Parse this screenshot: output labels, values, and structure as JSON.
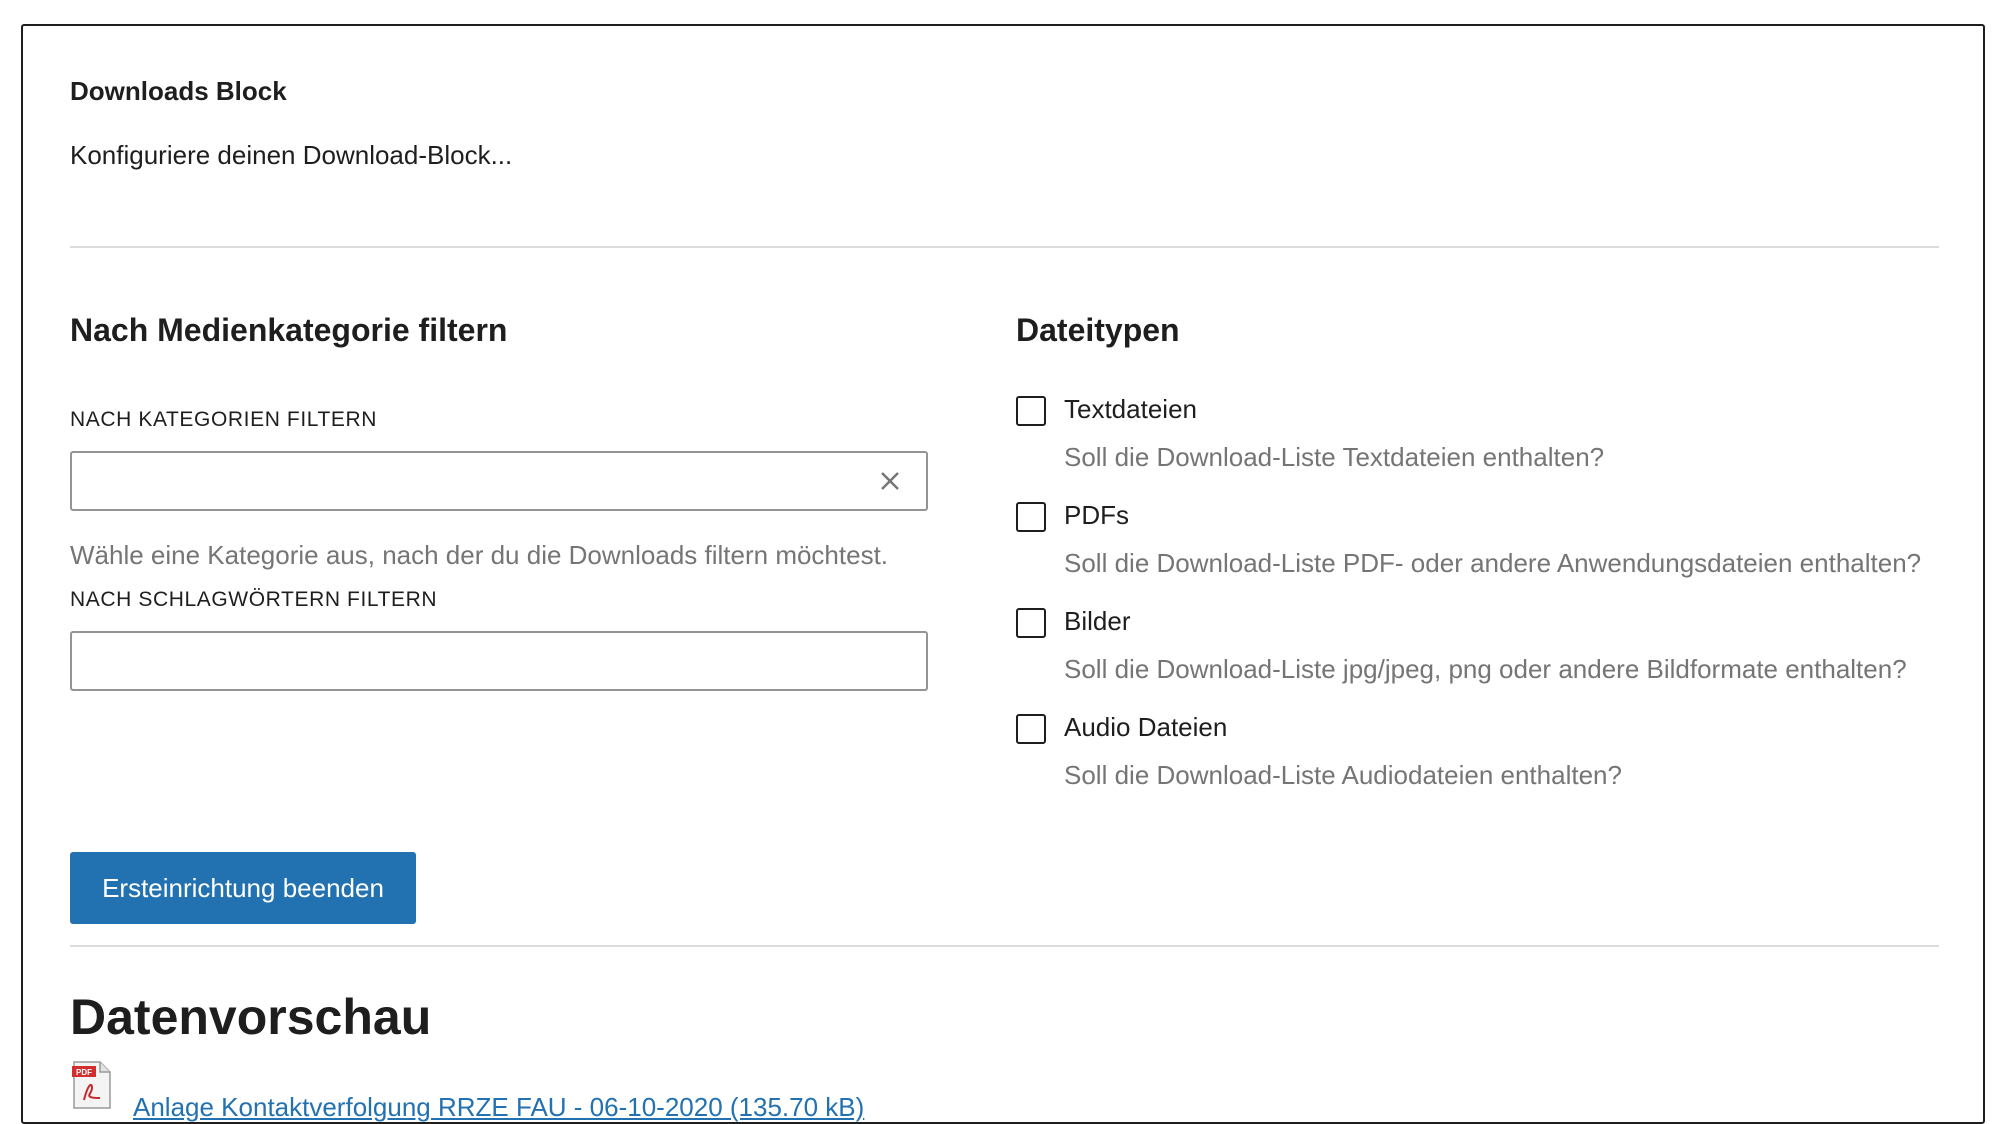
{
  "block": {
    "title": "Downloads Block",
    "description": "Konfiguriere deinen Download-Block..."
  },
  "filters": {
    "heading": "Nach Medienkategorie filtern",
    "category_label": "NACH KATEGORIEN FILTERN",
    "category_value": "",
    "category_help": "Wähle eine Kategorie aus, nach der du die Downloads filtern möchtest.",
    "tag_label": "NACH SCHLAGWÖRTERN FILTERN",
    "tag_value": ""
  },
  "filetypes": {
    "heading": "Dateitypen",
    "options": [
      {
        "label": "Textdateien",
        "help": "Soll die Download-Liste Textdateien enthalten?",
        "checked": false
      },
      {
        "label": "PDFs",
        "help": "Soll die Download-Liste PDF- oder andere Anwendungsdateien enthalten?",
        "checked": false
      },
      {
        "label": "Bilder",
        "help": "Soll die Download-Liste jpg/jpeg, png oder andere Bildformate enthalten?",
        "checked": false
      },
      {
        "label": "Audio Dateien",
        "help": "Soll die Download-Liste Audiodateien enthalten?",
        "checked": false
      }
    ]
  },
  "actions": {
    "finish_label": "Ersteinrichtung beenden"
  },
  "preview": {
    "heading": "Datenvorschau",
    "items": [
      {
        "icon": "pdf-file-icon",
        "link_text": "Anlage Kontaktverfolgung RRZE FAU - 06-10-2020 (135.70 kB)"
      }
    ]
  },
  "colors": {
    "accent": "#2271b1",
    "help_text": "#757575",
    "border": "#1e1e1e",
    "divider": "#dcdcde"
  }
}
